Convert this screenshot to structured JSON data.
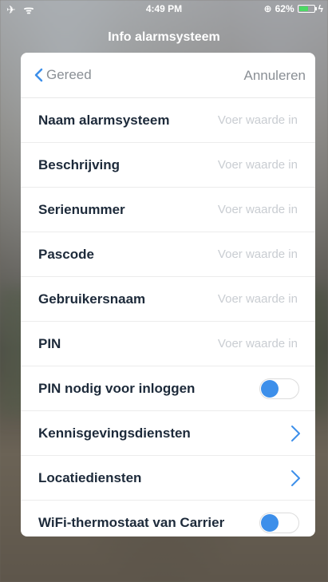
{
  "status": {
    "left_icons": "✈ ᯤ",
    "time": "4:49 PM",
    "location_icon": "⊕",
    "battery_percent": "62%",
    "battery_level": 0.62,
    "charging_icon": "ϟ"
  },
  "header": {
    "title": "Info alarmsysteem"
  },
  "card": {
    "back_label": "Gereed",
    "cancel_label": "Annuleren",
    "placeholder": "Voer waarde in",
    "fields": [
      {
        "label": "Naam alarmsysteem",
        "value": ""
      },
      {
        "label": "Beschrijving",
        "value": ""
      },
      {
        "label": "Serienummer",
        "value": ""
      },
      {
        "label": "Pascode",
        "value": ""
      },
      {
        "label": "Gebruikersnaam",
        "value": ""
      },
      {
        "label": "PIN",
        "value": ""
      }
    ],
    "pin_login": {
      "label": "PIN nodig voor inloggen",
      "enabled": false
    },
    "notifications": {
      "label": "Kennisgevingsdiensten"
    },
    "location": {
      "label": "Locatiediensten"
    },
    "wifi_thermostat": {
      "label": "WiFi-thermostaat van Carrier",
      "enabled": false
    }
  },
  "colors": {
    "accent": "#3d8fea",
    "label": "#1d2a3a",
    "muted": "#8a8f95",
    "placeholder": "#c9cdd2"
  }
}
